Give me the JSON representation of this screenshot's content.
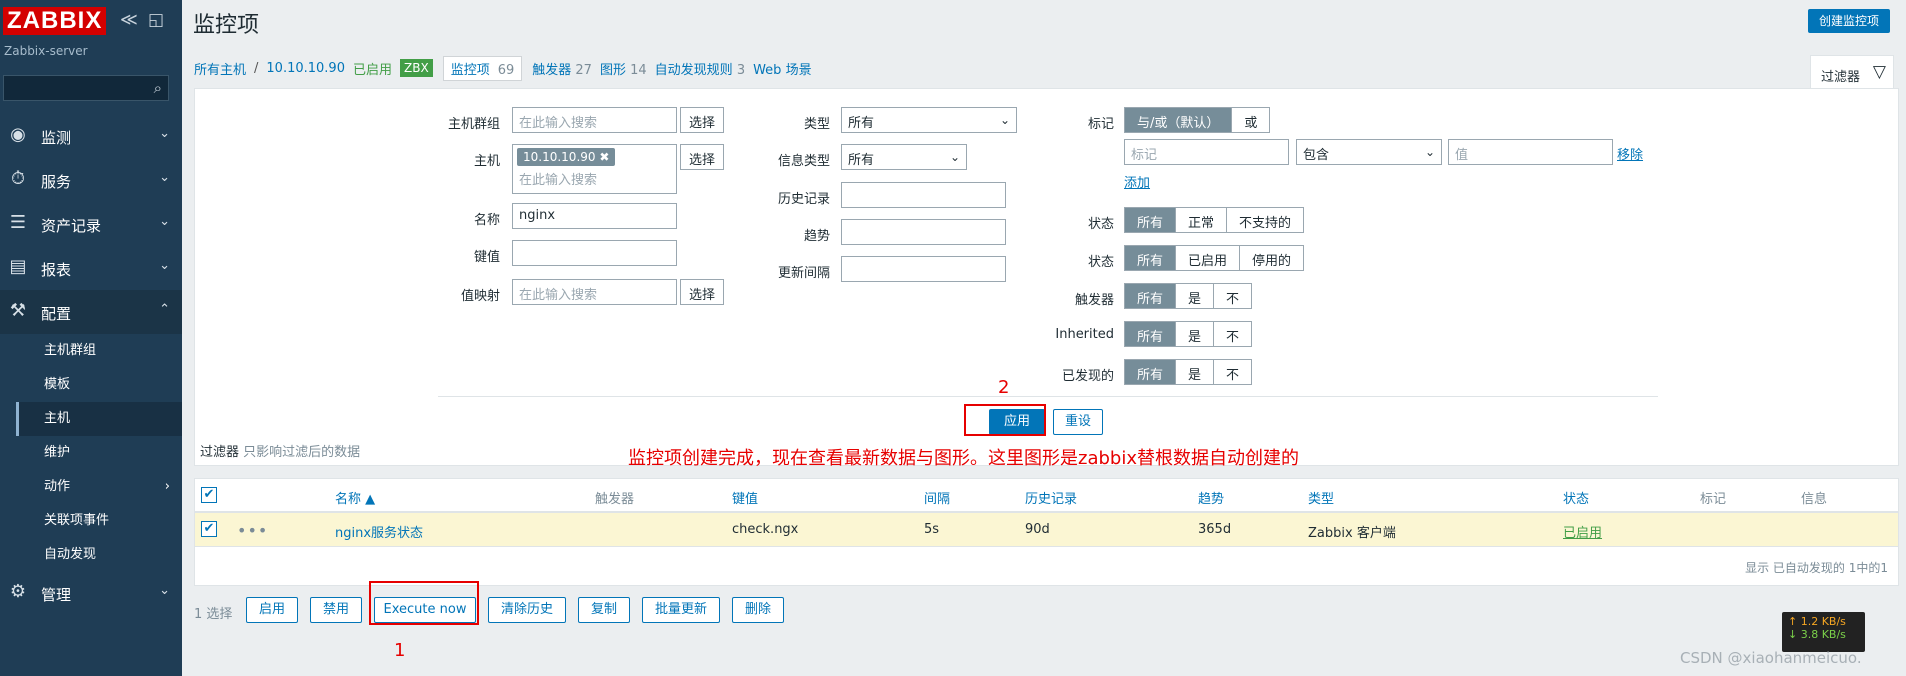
{
  "brand": {
    "logo": "ZABBIX",
    "server": "Zabbix-server",
    "collapse_glyph": "≪",
    "expand_glyph": "◱"
  },
  "sidebar": {
    "search_icon": "⌕",
    "items": [
      {
        "label": "监测",
        "icon": "eye-icon",
        "glyph": "◉"
      },
      {
        "label": "服务",
        "icon": "stopwatch-icon",
        "glyph": "⏱"
      },
      {
        "label": "资产记录",
        "icon": "list-icon",
        "glyph": "☰"
      },
      {
        "label": "报表",
        "icon": "bar-chart-icon",
        "glyph": "▤"
      },
      {
        "label": "配置",
        "icon": "wrench-icon",
        "glyph": "⚒"
      },
      {
        "label": "管理",
        "icon": "gear-icon",
        "glyph": "⚙"
      }
    ],
    "chevron_down": "⌄",
    "chevron_up": "⌃",
    "chevron_right": "›",
    "config_sub": [
      "主机群组",
      "模板",
      "主机",
      "维护",
      "动作",
      "关联项事件",
      "自动发现"
    ]
  },
  "header": {
    "title": "监控项",
    "create_button": "创建监控项"
  },
  "topbar": {
    "all_hosts": "所有主机",
    "sep": "/",
    "host": "10.10.10.90",
    "enabled": "已启用",
    "zbx": "ZBX",
    "items_label": "监控项",
    "items_count": "69",
    "triggers_label": "触发器",
    "triggers_count": "27",
    "graphs_label": "图形",
    "graphs_count": "14",
    "discovery_label": "自动发现规则",
    "discovery_count": "3",
    "web_label": "Web 场景"
  },
  "filter_tab": {
    "label": "过滤器",
    "icon_glyph": "▽"
  },
  "filter": {
    "host_group_label": "主机群组",
    "host_label": "主机",
    "name_label": "名称",
    "key_label": "键值",
    "valuemap_label": "值映射",
    "search_placeholder": "在此输入搜索",
    "select_button": "选择",
    "host_chip": "10.10.10.90",
    "chip_close": "✖",
    "name_value": "nginx",
    "type_label": "类型",
    "type_value": "所有",
    "info_type_label": "信息类型",
    "info_type_value": "所有",
    "history_label": "历史记录",
    "trends_label": "趋势",
    "interval_label": "更新间隔",
    "select_arrow": "⌄",
    "tags_label": "标记",
    "tags_and": "与/或（默认）",
    "tags_or": "或",
    "tag_placeholder": "标记",
    "tag_op": "包含",
    "tag_value_placeholder": "值",
    "remove": "移除",
    "add": "添加",
    "state_label": "状态",
    "state_options": [
      "所有",
      "正常",
      "不支持的"
    ],
    "status_label": "状态",
    "status_options": [
      "所有",
      "已启用",
      "停用的"
    ],
    "triggers_label": "触发器",
    "inherited_label": "Inherited",
    "discovered_label": "已发现的",
    "yesno_options": [
      "所有",
      "是",
      "不"
    ],
    "apply": "应用",
    "reset": "重设",
    "note_title": "过滤器",
    "note_sub": "只影响过滤后的数据"
  },
  "annotations": {
    "num1": "1",
    "num2": "2",
    "message": "监控项创建完成，现在查看最新数据与图形。这里图形是zabbix替根数据自动创建的"
  },
  "table": {
    "headers": {
      "name": "名称 ▲",
      "triggers": "触发器",
      "key": "键值",
      "interval": "间隔",
      "history": "历史记录",
      "trends": "趋势",
      "type": "类型",
      "status": "状态",
      "tags": "标记",
      "info": "信息"
    },
    "check_glyph": "✔",
    "dots": "•••",
    "row": {
      "name": "nginx服务状态",
      "key": "check.ngx",
      "interval": "5s",
      "history": "90d",
      "trends": "365d",
      "type": "Zabbix 客户端",
      "status": "已启用"
    },
    "footer": "显示 已自动发现的 1中的1"
  },
  "mass": {
    "selected": "1 选择",
    "buttons": [
      "启用",
      "禁用",
      "Execute now",
      "清除历史",
      "复制",
      "批量更新",
      "删除"
    ]
  },
  "network": {
    "up": "↑ 1.2 KB/s",
    "down": "↓ 3.8 KB/s"
  },
  "watermark": "CSDN @xiaohanmeicuo."
}
